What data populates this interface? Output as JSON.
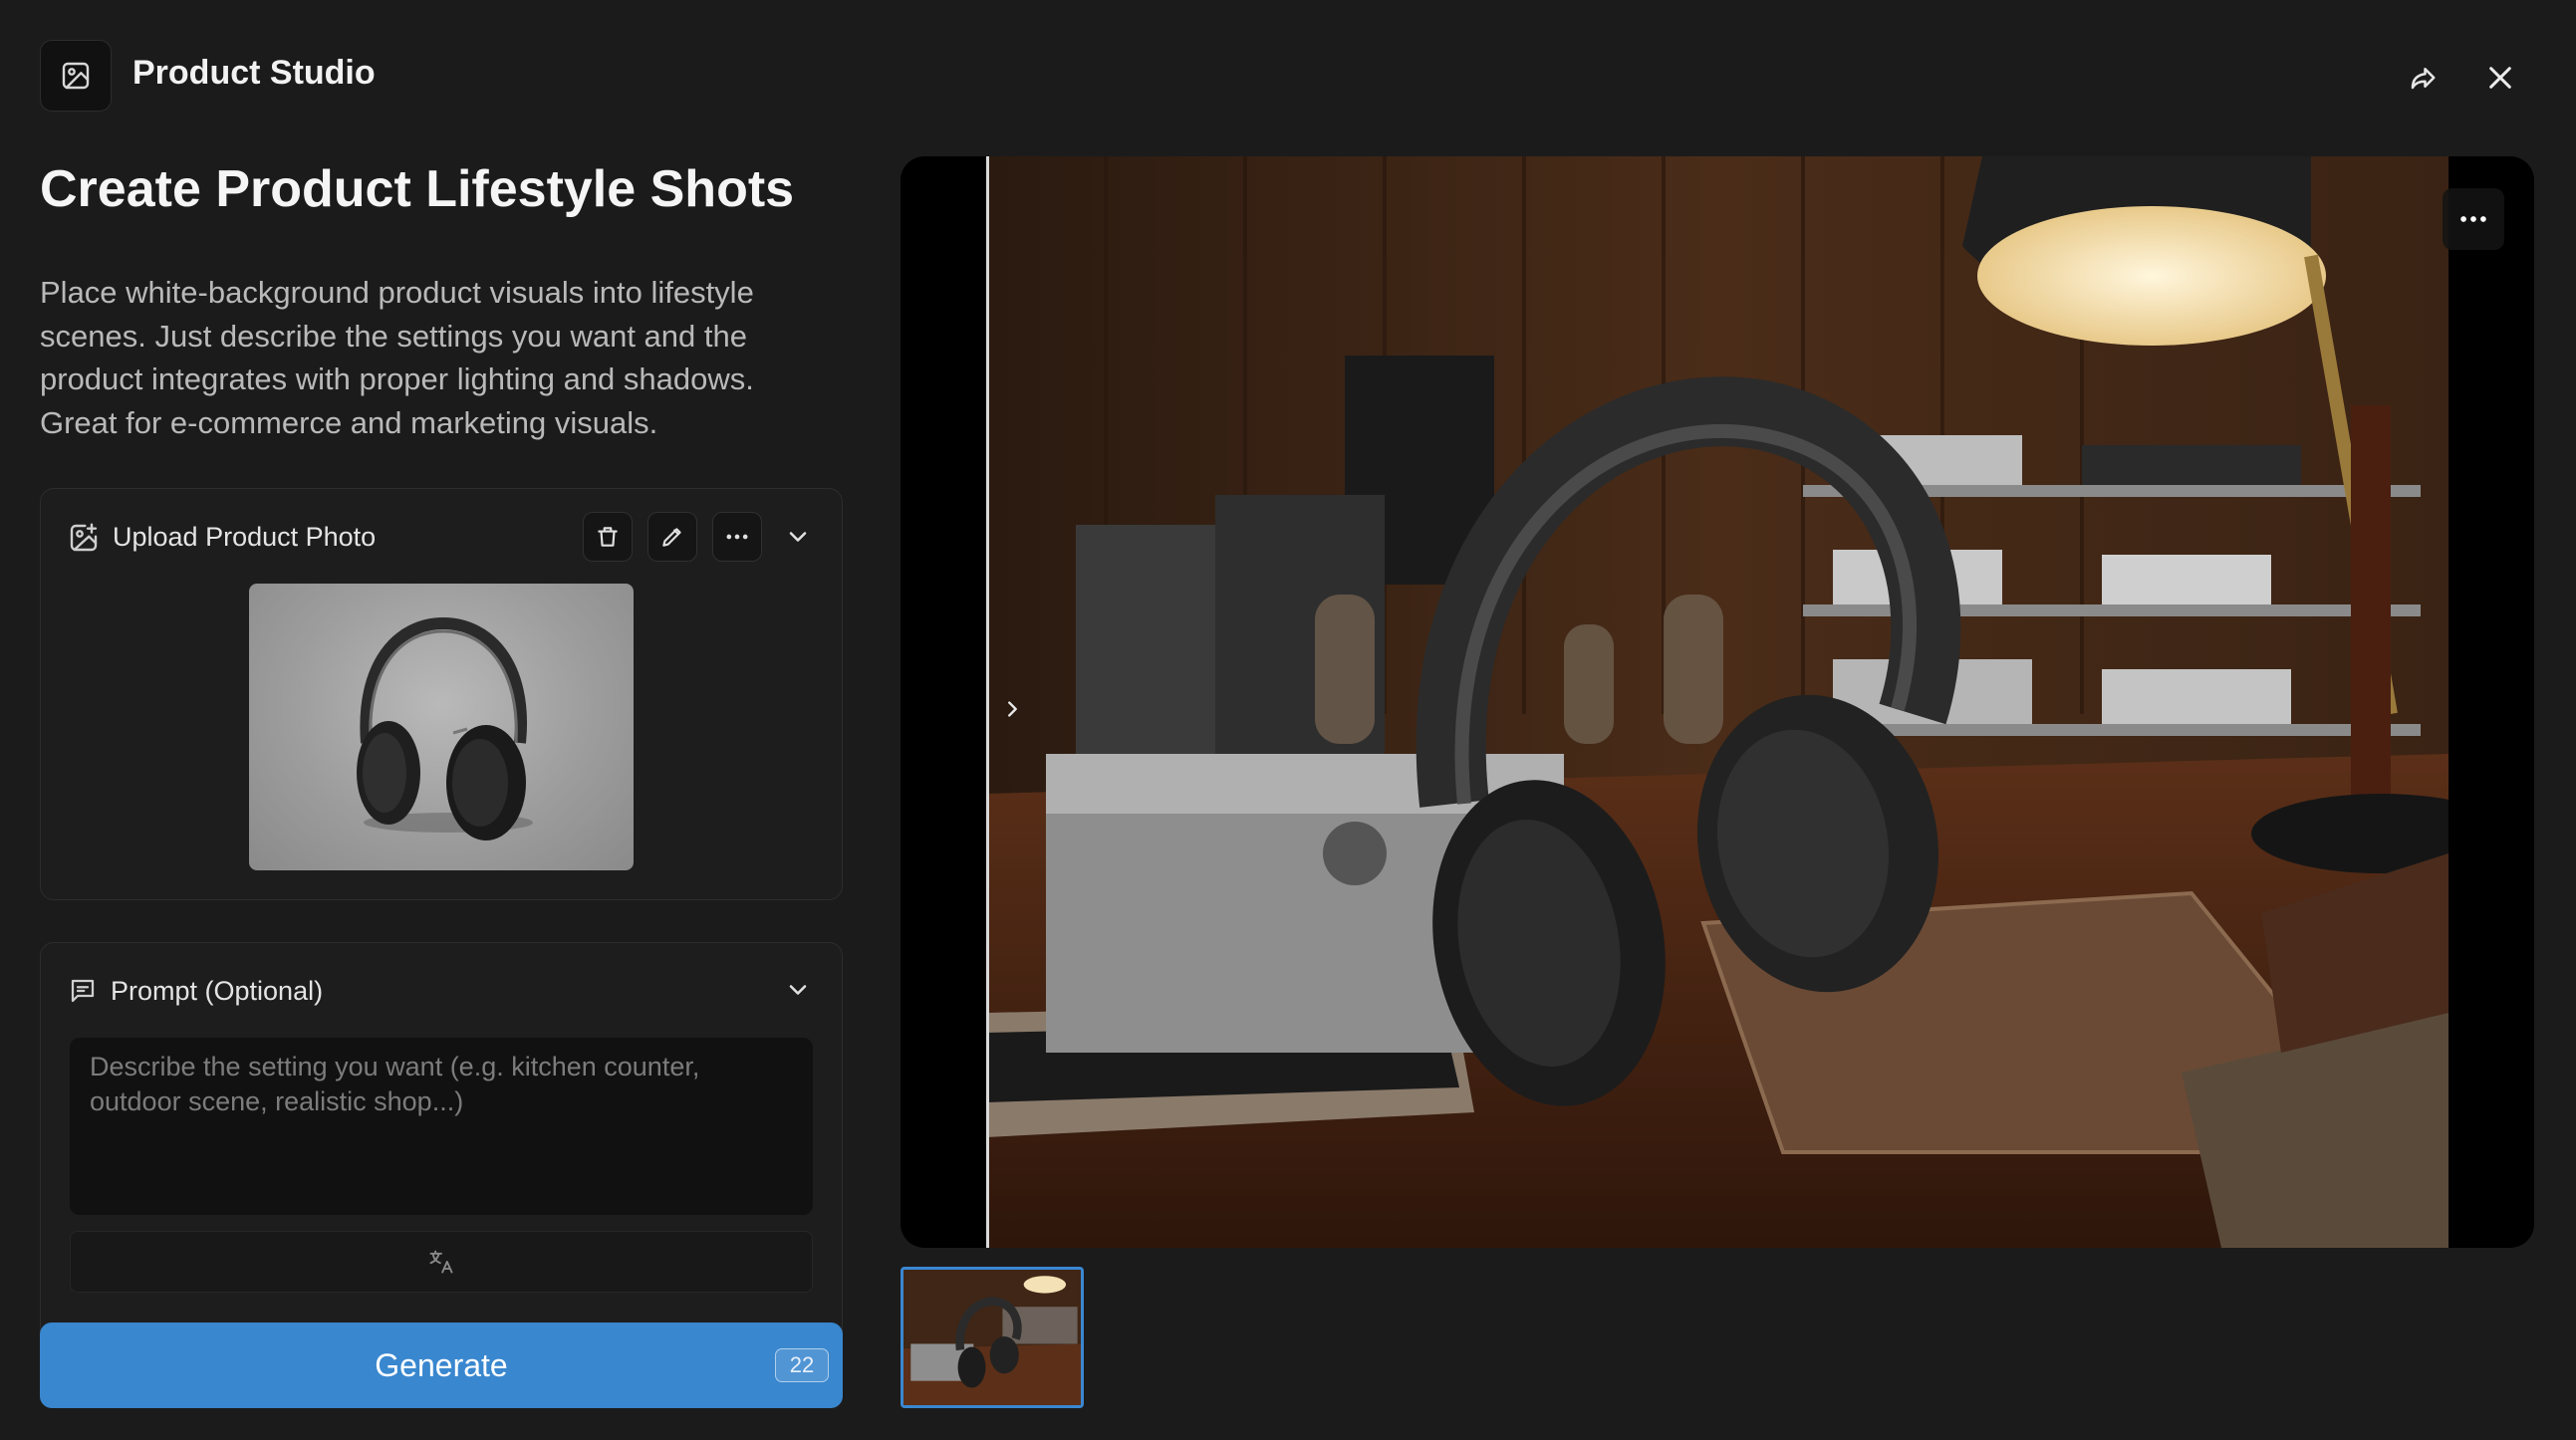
{
  "app": {
    "title": "Product Studio"
  },
  "page": {
    "title": "Create Product Lifestyle Shots",
    "description": "Place white-background product visuals into lifestyle scenes. Just describe the settings you want and the product integrates with proper lighting and shadows. Great for e-commerce and marketing visuals."
  },
  "upload": {
    "label": "Upload Product Photo"
  },
  "prompt": {
    "label": "Prompt (Optional)",
    "placeholder": "Describe the setting you want (e.g. kitchen counter, outdoor scene, realistic shop...)",
    "value": ""
  },
  "generate": {
    "label": "Generate",
    "credits": "22"
  },
  "colors": {
    "accent": "#3987cf",
    "background": "#1b1b1b",
    "panel": "#1d1d1d"
  },
  "icons": {
    "app": "image-icon",
    "share": "share-icon",
    "close": "close-icon",
    "upload": "image-add-icon",
    "delete": "trash-icon",
    "edit": "pencil-icon",
    "more": "more-horizontal-icon",
    "collapse": "chevron-down-icon",
    "prompt": "message-icon",
    "translate": "translate-icon",
    "compare": "chevron-right-icon"
  }
}
